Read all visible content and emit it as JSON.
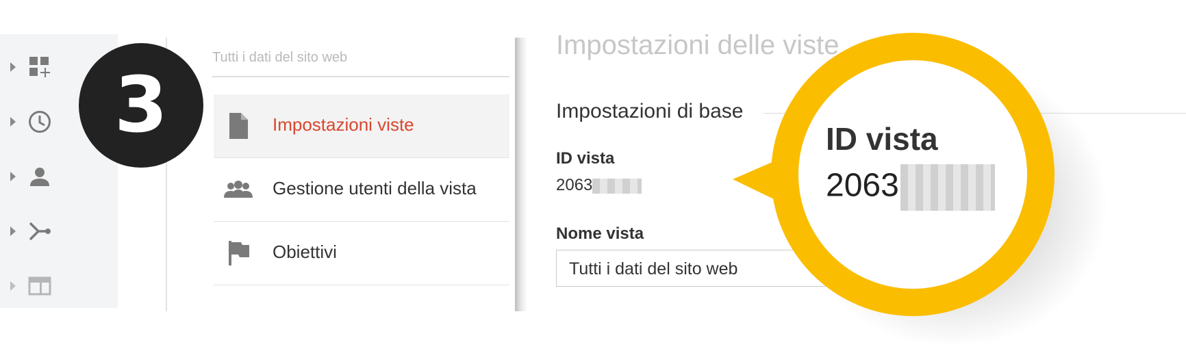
{
  "step": {
    "number": "3"
  },
  "rail": {
    "items": [
      {
        "icon": "dashboard-add-icon"
      },
      {
        "icon": "clock-icon"
      },
      {
        "icon": "person-icon"
      },
      {
        "icon": "merge-icon"
      },
      {
        "icon": "layout-icon"
      }
    ]
  },
  "view_menu": {
    "breadcrumb": "Tutti i dati del sito web",
    "items": [
      {
        "label": "Impostazioni viste",
        "icon": "document-icon",
        "active": true
      },
      {
        "label": "Gestione utenti della vista",
        "icon": "group-icon",
        "active": false
      },
      {
        "label": "Obiettivi",
        "icon": "flag-icon",
        "active": false
      }
    ]
  },
  "settings": {
    "title": "Impostazioni delle viste",
    "section": "Impostazioni di base",
    "view_id_label": "ID vista",
    "view_id_value": "2063",
    "view_name_label": "Nome vista",
    "view_name_value": "Tutti i dati del sito web"
  },
  "callout": {
    "label": "ID vista",
    "value": "2063"
  },
  "colors": {
    "accent_red": "#d9472f",
    "callout_yellow": "#fbbd00",
    "badge_dark": "#222222"
  }
}
